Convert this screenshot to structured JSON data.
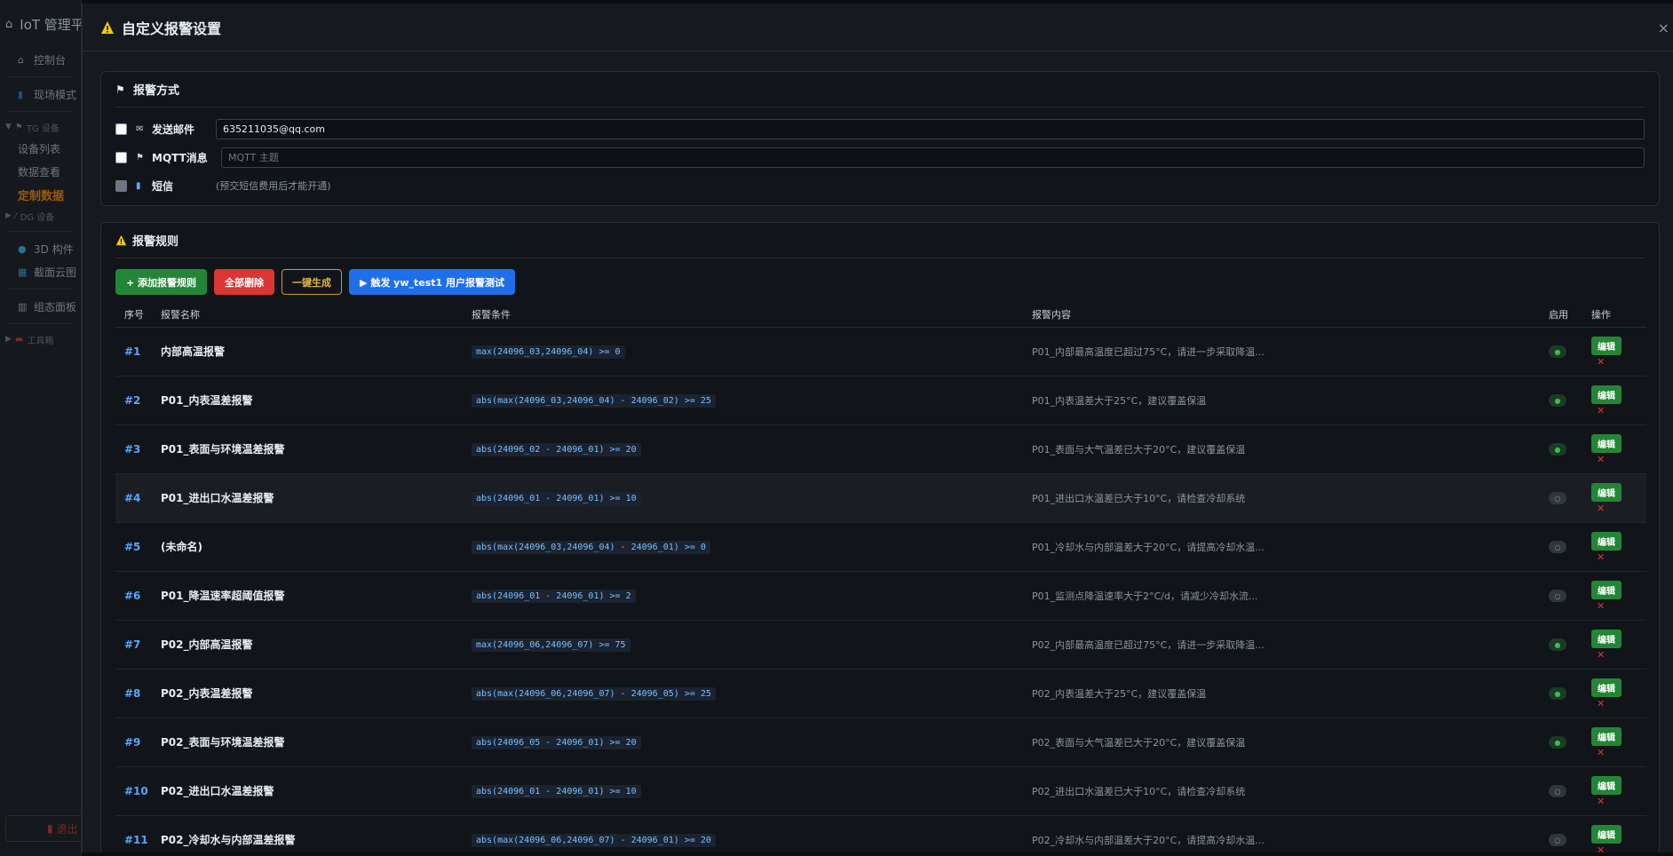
{
  "sidebar": {
    "brand": "IoT 管理平",
    "items": [
      {
        "label": "控制台"
      },
      {
        "label": "现场模式"
      }
    ],
    "tg_group": "TG 设备",
    "tg_items": [
      {
        "label": "设备列表"
      },
      {
        "label": "数据查看"
      },
      {
        "label": "定制数据"
      }
    ],
    "dg_group": "DG 设备",
    "other_items": [
      {
        "label": "3D 构件"
      },
      {
        "label": "截面云图"
      },
      {
        "label": "组态面板"
      }
    ],
    "tools_group": "工具箱",
    "logout": "退出"
  },
  "modal": {
    "title": "自定义报警设置",
    "close": "×"
  },
  "methods": {
    "title": "报警方式",
    "email_label": "发送邮件",
    "email_value": "635211035@qq.com",
    "mqtt_label": "MQTT消息",
    "mqtt_placeholder": "MQTT 主题",
    "sms_label": "短信",
    "sms_note": "(预交短信费用后才能开通)"
  },
  "rules": {
    "title": "报警规则",
    "buttons": {
      "add": "+ 添加报警规则",
      "delete_all": "全部删除",
      "generate": "一键生成",
      "trigger": "▶ 触发 yw_test1 用户报警测试"
    },
    "headers": {
      "index": "序号",
      "name": "报警名称",
      "condition": "报警条件",
      "content": "报警内容",
      "enabled": "启用",
      "actions": "操作"
    },
    "edit_label": "编辑",
    "delete_label": "✕",
    "rows": [
      {
        "index": "#1",
        "name": "内部高温报警",
        "condition": "max(24096_03,24096_04) >= 0",
        "content": "P01_内部最高温度已超过75°C，请进一步采取降温...",
        "enabled": true
      },
      {
        "index": "#2",
        "name": "P01_内表温差报警",
        "condition": "abs(max(24096_03,24096_04) - 24096_02) >= 25",
        "content": "P01_内表温差大于25°C，建议覆盖保温",
        "enabled": true
      },
      {
        "index": "#3",
        "name": "P01_表面与环境温差报警",
        "condition": "abs(24096_02 - 24096_01) >= 20",
        "content": "P01_表面与大气温差已大于20°C，建议覆盖保温",
        "enabled": true
      },
      {
        "index": "#4",
        "name": "P01_进出口水温差报警",
        "condition": "abs(24096_01 - 24096_01) >= 10",
        "content": "P01_进出口水温差已大于10°C，请检查冷却系统",
        "enabled": false
      },
      {
        "index": "#5",
        "name": "(未命名)",
        "condition": "abs(max(24096_03,24096_04) - 24096_01) >= 0",
        "content": "P01_冷却水与内部温差大于20°C，请提高冷却水温...",
        "enabled": false
      },
      {
        "index": "#6",
        "name": "P01_降温速率超阈值报警",
        "condition": "abs(24096_01 - 24096_01) >= 2",
        "content": "P01_监测点降温速率大于2°C/d，请减少冷却水流...",
        "enabled": false
      },
      {
        "index": "#7",
        "name": "P02_内部高温报警",
        "condition": "max(24096_06,24096_07) >= 75",
        "content": "P02_内部最高温度已超过75°C，请进一步采取降温...",
        "enabled": true
      },
      {
        "index": "#8",
        "name": "P02_内表温差报警",
        "condition": "abs(max(24096_06,24096_07) - 24096_05) >= 25",
        "content": "P02_内表温差大于25°C，建议覆盖保温",
        "enabled": true
      },
      {
        "index": "#9",
        "name": "P02_表面与环境温差报警",
        "condition": "abs(24096_05 - 24096_01) >= 20",
        "content": "P02_表面与大气温差已大于20°C，建议覆盖保温",
        "enabled": true
      },
      {
        "index": "#10",
        "name": "P02_进出口水温差报警",
        "condition": "abs(24096_01 - 24096_01) >= 10",
        "content": "P02_进出口水温差已大于10°C，请检查冷却系统",
        "enabled": false
      },
      {
        "index": "#11",
        "name": "P02_冷却水与内部温差报警",
        "condition": "abs(max(24096_06,24096_07) - 24096_01) >= 20",
        "content": "P02_冷却水与内部温差大于20°C，请提高冷却水温...",
        "enabled": false
      }
    ]
  },
  "colors": {
    "accent_green": "#238636",
    "accent_red": "#da3633",
    "accent_blue": "#1f6feb",
    "accent_yellow": "#d29922",
    "index_blue": "#58a6ff"
  }
}
